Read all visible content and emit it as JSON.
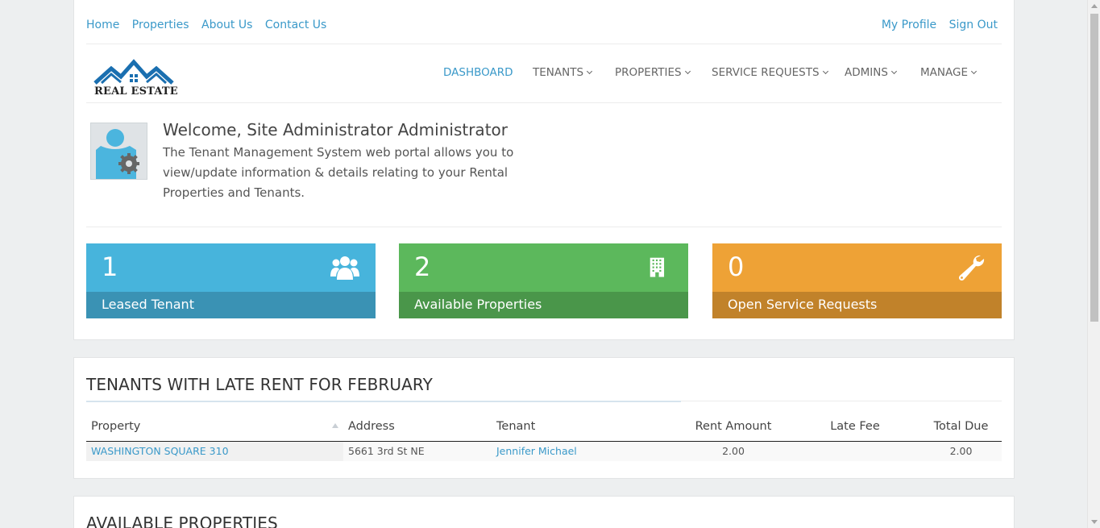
{
  "topnav": {
    "links": [
      "Home",
      "Properties",
      "About Us",
      "Contact Us"
    ],
    "user_links": [
      "My Profile",
      "Sign Out"
    ]
  },
  "brand": {
    "logo_text": "REAL ESTATE",
    "color": "#1a6fb0"
  },
  "mainnav": {
    "items": [
      {
        "label": "DASHBOARD",
        "active": true
      },
      {
        "label": "TENANTS",
        "dropdown": true
      },
      {
        "label": "PROPERTIES",
        "dropdown": true
      },
      {
        "label": "SERVICE REQUESTS",
        "dropdown": true
      },
      {
        "label": "ADMINS",
        "dropdown": true
      },
      {
        "label": "MANAGE",
        "dropdown": true
      }
    ]
  },
  "welcome": {
    "title": "Welcome, Site Administrator Administrator",
    "text": "The Tenant Management System web portal allows you to view/update information & details relating to your Rental Properties and Tenants.",
    "avatar_icon": "admin-user-gear-icon"
  },
  "stats": [
    {
      "value": "1",
      "label": "Leased Tenant",
      "icon": "users-icon",
      "color": "#47b4dc"
    },
    {
      "value": "2",
      "label": "Available Properties",
      "icon": "building-icon",
      "color": "#5cb85c"
    },
    {
      "value": "0",
      "label": "Open Service Requests",
      "icon": "wrench-icon",
      "color": "#eea236"
    }
  ],
  "late_rent": {
    "title": "TENANTS WITH LATE RENT FOR FEBRUARY",
    "columns": [
      "Property",
      "Address",
      "Tenant",
      "Rent Amount",
      "Late Fee",
      "Total Due"
    ],
    "rows": [
      {
        "property": "WASHINGTON SQUARE 310",
        "address": "5661 3rd St NE",
        "tenant": "Jennifer Michael",
        "rent_amount": "2.00",
        "late_fee": "",
        "total_due": "2.00"
      }
    ]
  },
  "available": {
    "title": "AVAILABLE PROPERTIES"
  }
}
